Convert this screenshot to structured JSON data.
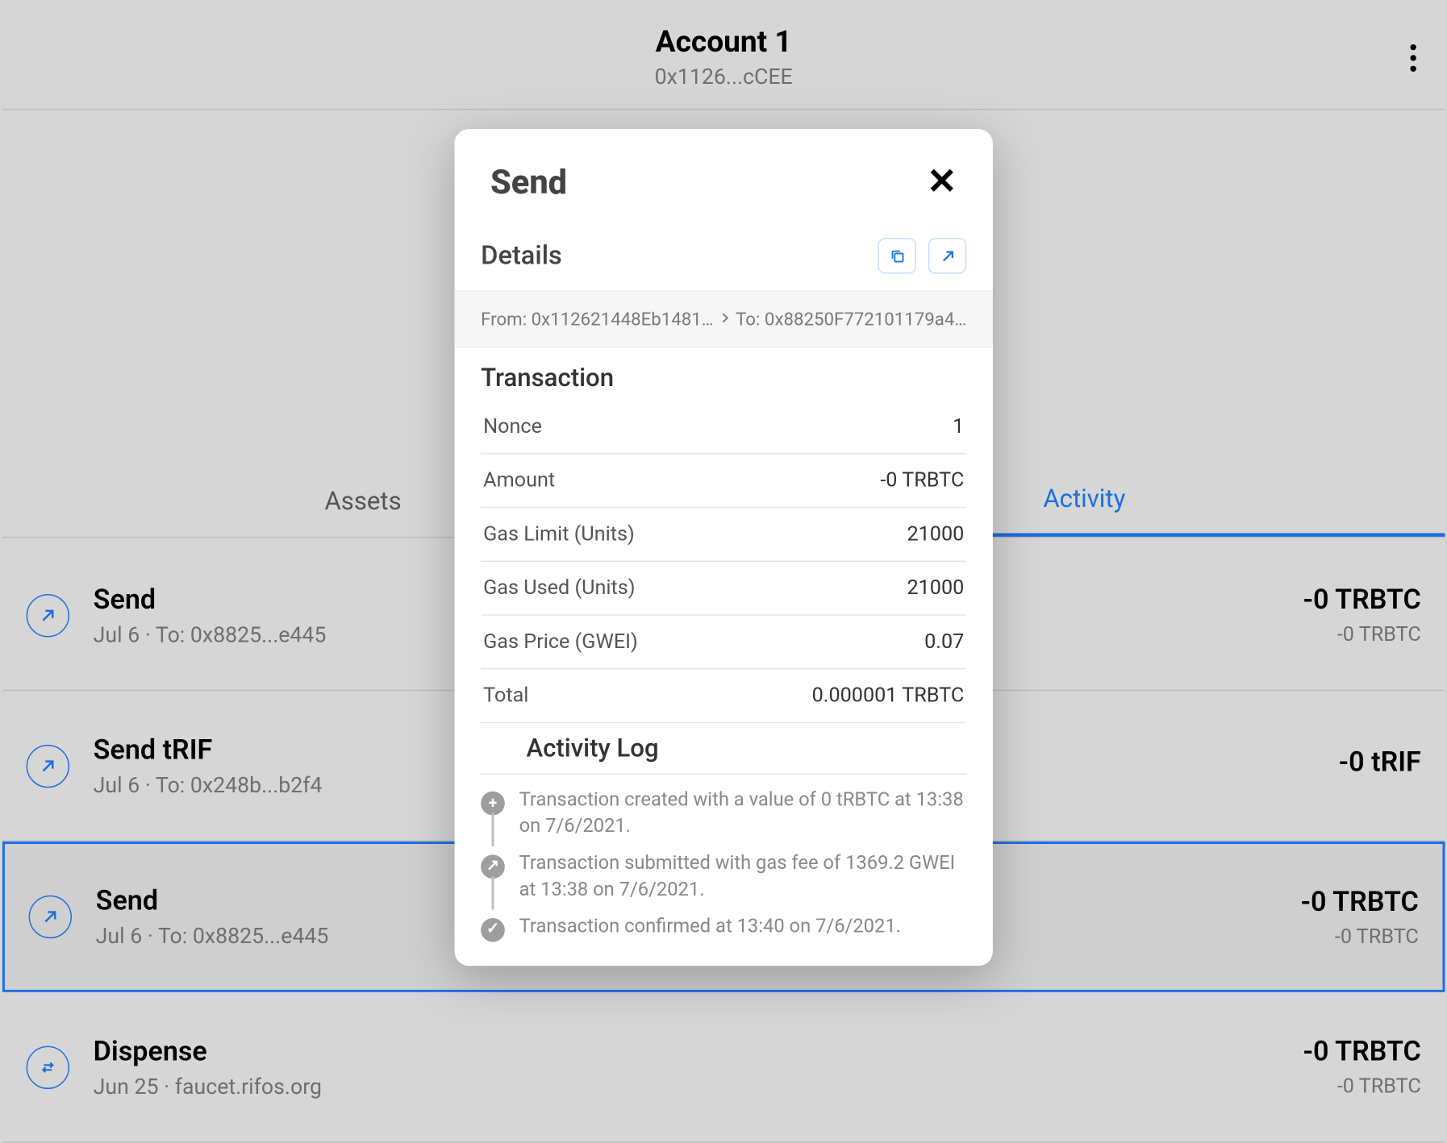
{
  "header": {
    "account_name": "Account 1",
    "account_address": "0x1126...cCEE"
  },
  "tabs": {
    "assets": "Assets",
    "activity": "Activity"
  },
  "transactions": [
    {
      "title": "Send",
      "sub": "Jul 6 · To: 0x8825...e445",
      "amount": "-0 TRBTC",
      "amount_sub": "-0 TRBTC",
      "icon": "arrow-up-right",
      "selected": false
    },
    {
      "title": "Send tRIF",
      "sub": "Jul 6 · To: 0x248b...b2f4",
      "amount": "-0 tRIF",
      "amount_sub": "",
      "icon": "arrow-up-right",
      "selected": false
    },
    {
      "title": "Send",
      "sub": "Jul 6 · To: 0x8825...e445",
      "amount": "-0 TRBTC",
      "amount_sub": "-0 TRBTC",
      "icon": "arrow-up-right",
      "selected": true
    },
    {
      "title": "Dispense",
      "sub": "Jun 25 · faucet.rifos.org",
      "amount": "-0 TRBTC",
      "amount_sub": "-0 TRBTC",
      "icon": "swap",
      "selected": false
    }
  ],
  "modal": {
    "title": "Send",
    "details_label": "Details",
    "from": "From: 0x112621448Eb1481…",
    "to": "To: 0x88250F772101179a4…",
    "transaction_label": "Transaction",
    "nonce_label": "Nonce",
    "nonce_value": "1",
    "amount_label": "Amount",
    "amount_value": "-0 TRBTC",
    "gas_limit_label": "Gas Limit (Units)",
    "gas_limit_value": "21000",
    "gas_used_label": "Gas Used (Units)",
    "gas_used_value": "21000",
    "gas_price_label": "Gas Price (GWEI)",
    "gas_price_value": "0.07",
    "total_label": "Total",
    "total_value": "0.000001 TRBTC",
    "activity_log_label": "Activity Log",
    "log": [
      "Transaction created with a value of 0 tRBTC at 13:38 on 7/6/2021.",
      "Transaction submitted with gas fee of 1369.2 GWEI at 13:38 on 7/6/2021.",
      "Transaction confirmed at 13:40 on 7/6/2021."
    ]
  }
}
